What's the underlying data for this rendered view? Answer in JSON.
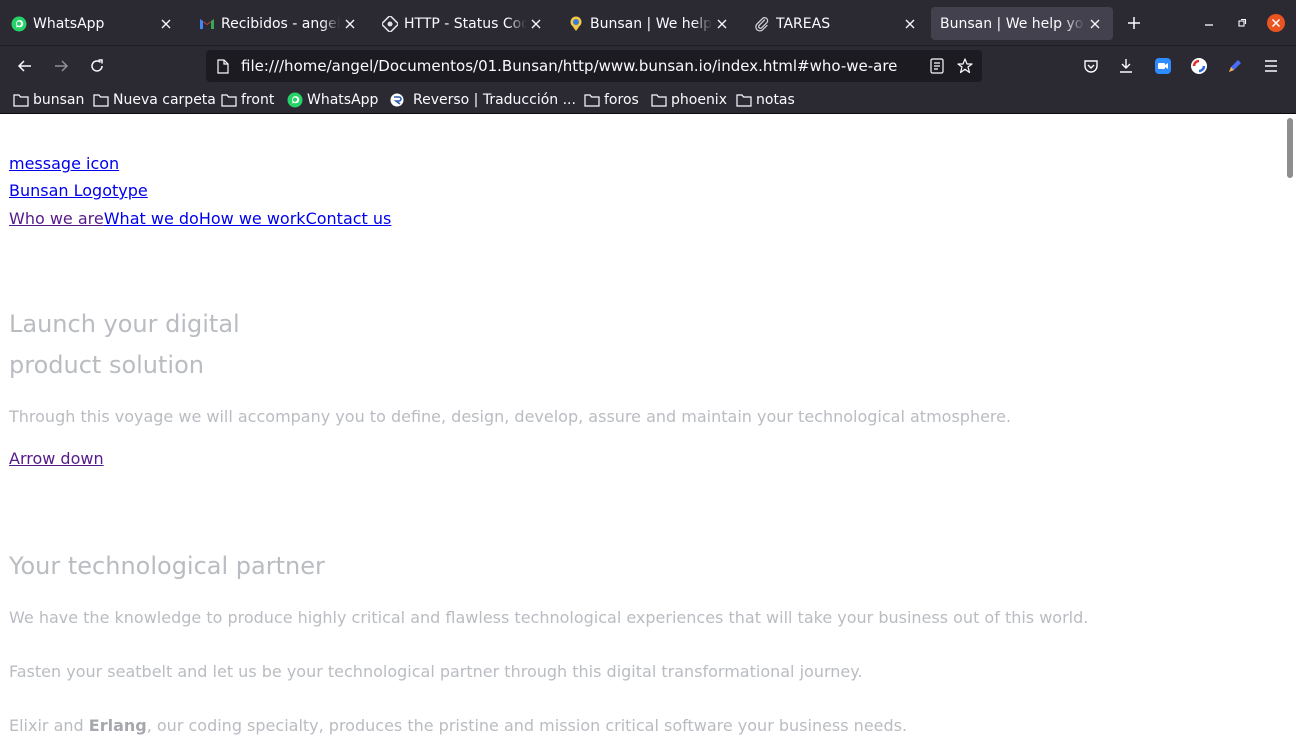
{
  "browser": {
    "tabs": [
      {
        "label": "WhatsApp",
        "icon": "whatsapp-icon",
        "active": false
      },
      {
        "label": "Recibidos - angel.hu",
        "icon": "gmail-icon",
        "active": false
      },
      {
        "label": "HTTP - Status Code",
        "icon": "http-icon",
        "active": false
      },
      {
        "label": "Bunsan | We help yo",
        "icon": "bunsan-icon",
        "active": false
      },
      {
        "label": "TAREAS",
        "icon": "paperclip-icon",
        "active": false
      },
      {
        "label": "Bunsan | We help you a",
        "icon": "",
        "active": true
      }
    ],
    "url": "file:///home/angel/Documentos/01.Bunsan/http/www.bunsan.io/index.html#who-we-are",
    "bookmarks": [
      {
        "label": "bunsan",
        "icon": "folder-icon"
      },
      {
        "label": "Nueva carpeta",
        "icon": "folder-icon"
      },
      {
        "label": "front",
        "icon": "folder-icon"
      },
      {
        "label": "WhatsApp",
        "icon": "whatsapp-icon"
      },
      {
        "label": "Reverso | Traducción ...",
        "icon": "reverso-icon"
      },
      {
        "label": "foros",
        "icon": "folder-icon"
      },
      {
        "label": "phoenix",
        "icon": "folder-icon"
      },
      {
        "label": "notas",
        "icon": "folder-icon"
      }
    ],
    "colors": {
      "chrome": "#2b2a33",
      "urlbar": "#1c1b22",
      "active_tab": "#42414d",
      "close_red": "#e95420"
    }
  },
  "page": {
    "links": {
      "message_icon": "message icon",
      "logotype": "Bunsan Logotype",
      "nav": [
        "Who we are",
        "What we do",
        "How we work",
        "Contact us"
      ],
      "arrow_down": "Arrow down"
    },
    "hero": {
      "title_line1": "Launch your digital",
      "title_line2": "product solution",
      "subtitle": "Through this voyage we will accompany you to define, design, develop, assure and maintain your technological atmosphere."
    },
    "partner": {
      "title": "Your technological partner",
      "p1": "We have the knowledge to produce highly critical and flawless technological experiences that will take your business out of this world.",
      "p2": "Fasten your seatbelt and let us be your technological partner through this digital transformational journey.",
      "p3_pre": "Elixir and ",
      "p3_bold": "Erlang",
      "p3_post": ", our coding specialty, produces the pristine and mission critical software your business needs."
    },
    "colors": {
      "link": "#0000ee",
      "visited": "#551a8b",
      "muted_text": "#b9bcc1"
    }
  }
}
